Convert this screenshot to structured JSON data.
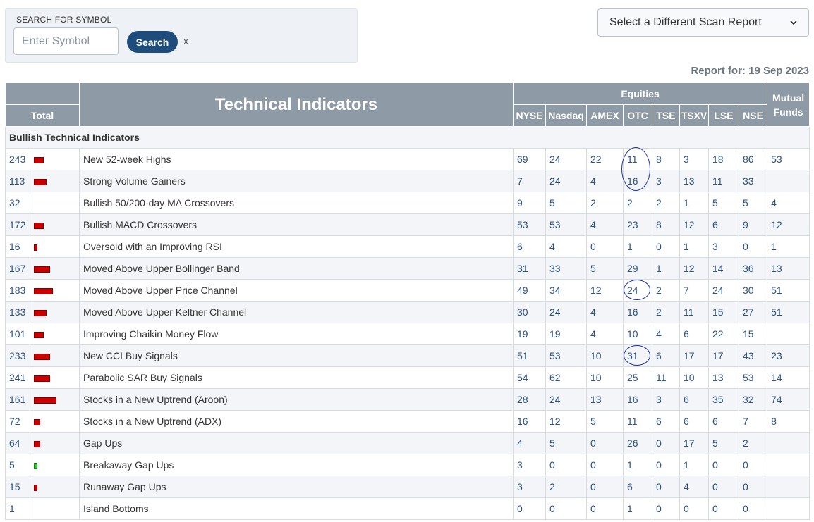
{
  "search": {
    "title": "SEARCH FOR SYMBOL",
    "placeholder": "Enter Symbol",
    "button_label": "Search",
    "clear_label": "x"
  },
  "scan_select": {
    "selected": "Select a Different Scan Report"
  },
  "report": {
    "label": "Report for: 19 Sep 2023"
  },
  "table": {
    "title": "Technical Indicators",
    "total_label": "Total",
    "equities_label": "Equities",
    "mutual_label_line1": "Mutual",
    "mutual_label_line2": "Funds",
    "exchanges": [
      "NYSE",
      "Nasdaq",
      "AMEX",
      "OTC",
      "TSE",
      "TSXV",
      "LSE",
      "NSE"
    ],
    "section_label": "Bullish Technical Indicators",
    "bar_color": "#cc0000",
    "bar_color_low": "#33cc33",
    "rows": [
      {
        "total": "243",
        "bar": 3,
        "name": "New 52-week Highs",
        "values": [
          "69",
          "24",
          "22",
          "11",
          "8",
          "3",
          "18",
          "86",
          "53"
        ]
      },
      {
        "total": "113",
        "bar": 4,
        "name": "Strong Volume Gainers",
        "values": [
          "7",
          "24",
          "4",
          "16",
          "3",
          "13",
          "11",
          "33",
          ""
        ]
      },
      {
        "total": "32",
        "bar": 0,
        "name": "Bullish 50/200-day MA Crossovers",
        "values": [
          "9",
          "5",
          "2",
          "2",
          "2",
          "1",
          "5",
          "5",
          "4"
        ]
      },
      {
        "total": "172",
        "bar": 3,
        "name": "Bullish MACD Crossovers",
        "values": [
          "53",
          "53",
          "4",
          "23",
          "8",
          "12",
          "6",
          "9",
          "12"
        ]
      },
      {
        "total": "16",
        "bar": 1,
        "name": "Oversold with an Improving RSI",
        "values": [
          "6",
          "4",
          "0",
          "1",
          "0",
          "1",
          "3",
          "0",
          "1"
        ]
      },
      {
        "total": "167",
        "bar": 5,
        "name": "Moved Above Upper Bollinger Band",
        "values": [
          "31",
          "33",
          "5",
          "29",
          "1",
          "12",
          "14",
          "36",
          "13"
        ]
      },
      {
        "total": "183",
        "bar": 6,
        "name": "Moved Above Upper Price Channel",
        "values": [
          "49",
          "34",
          "12",
          "24",
          "2",
          "7",
          "24",
          "30",
          "51"
        ]
      },
      {
        "total": "133",
        "bar": 4,
        "name": "Moved Above Upper Keltner Channel",
        "values": [
          "30",
          "24",
          "4",
          "16",
          "2",
          "11",
          "15",
          "27",
          "51"
        ]
      },
      {
        "total": "101",
        "bar": 3,
        "name": "Improving Chaikin Money Flow",
        "values": [
          "19",
          "19",
          "4",
          "10",
          "4",
          "6",
          "22",
          "15",
          ""
        ]
      },
      {
        "total": "233",
        "bar": 5,
        "name": "New CCI Buy Signals",
        "values": [
          "51",
          "53",
          "10",
          "31",
          "6",
          "17",
          "17",
          "43",
          "23"
        ]
      },
      {
        "total": "241",
        "bar": 5,
        "name": "Parabolic SAR Buy Signals",
        "values": [
          "54",
          "62",
          "10",
          "25",
          "11",
          "10",
          "13",
          "53",
          "14"
        ]
      },
      {
        "total": "161",
        "bar": 7,
        "name": "Stocks in a New Uptrend (Aroon)",
        "values": [
          "28",
          "24",
          "13",
          "16",
          "3",
          "6",
          "35",
          "32",
          "74"
        ]
      },
      {
        "total": "72",
        "bar": 2,
        "name": "Stocks in a New Uptrend (ADX)",
        "values": [
          "16",
          "12",
          "5",
          "11",
          "6",
          "6",
          "6",
          "7",
          "8"
        ]
      },
      {
        "total": "64",
        "bar": 2,
        "name": "Gap Ups",
        "values": [
          "4",
          "5",
          "0",
          "26",
          "0",
          "17",
          "5",
          "2",
          ""
        ]
      },
      {
        "total": "5",
        "bar": 1,
        "barColor": "green",
        "name": "Breakaway Gap Ups",
        "values": [
          "3",
          "0",
          "0",
          "1",
          "0",
          "1",
          "0",
          "0",
          ""
        ]
      },
      {
        "total": "15",
        "bar": 1,
        "name": "Runaway Gap Ups",
        "values": [
          "3",
          "2",
          "0",
          "6",
          "0",
          "4",
          "0",
          "0",
          ""
        ]
      },
      {
        "total": "1",
        "bar": 0,
        "name": "Island Bottoms",
        "values": [
          "0",
          "0",
          "0",
          "1",
          "0",
          "0",
          "0",
          "0",
          ""
        ]
      }
    ]
  }
}
